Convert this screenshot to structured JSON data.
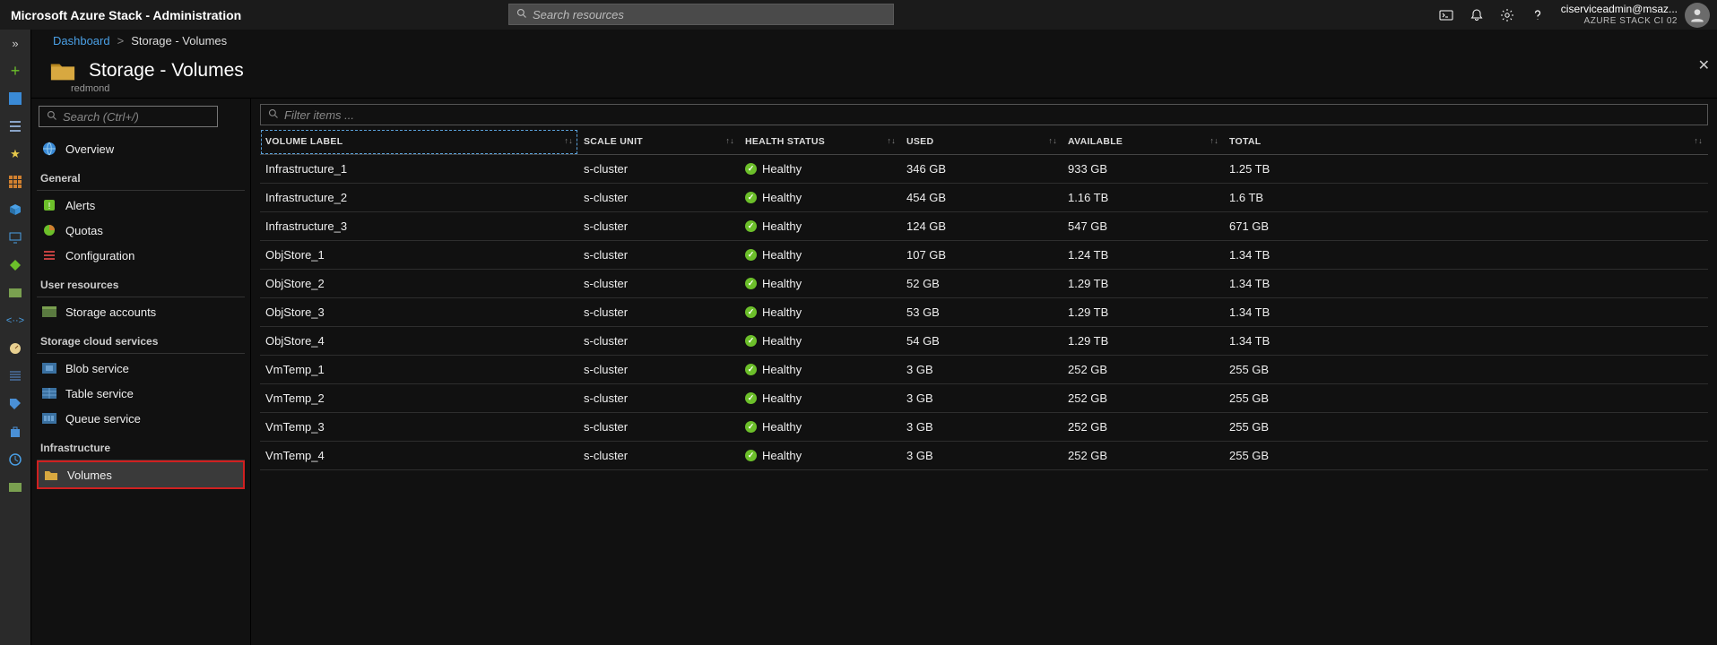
{
  "topbar": {
    "title": "Microsoft Azure Stack - Administration",
    "search_placeholder": "Search resources",
    "user": {
      "name": "ciserviceadmin@msaz...",
      "tenant": "AZURE STACK CI 02"
    }
  },
  "breadcrumb": {
    "root": "Dashboard",
    "sep": ">",
    "current": "Storage - Volumes"
  },
  "blade": {
    "title": "Storage - Volumes",
    "subtitle": "redmond"
  },
  "sidebar": {
    "search_placeholder": "Search (Ctrl+/)",
    "overview": "Overview",
    "groups": {
      "general": "General",
      "user_resources": "User resources",
      "storage_cloud": "Storage cloud services",
      "infrastructure": "Infrastructure"
    },
    "items": {
      "alerts": "Alerts",
      "quotas": "Quotas",
      "configuration": "Configuration",
      "storage_accounts": "Storage accounts",
      "blob_service": "Blob service",
      "table_service": "Table service",
      "queue_service": "Queue service",
      "volumes": "Volumes"
    }
  },
  "table": {
    "filter_placeholder": "Filter items ...",
    "headers": {
      "label": "VOLUME LABEL",
      "scale": "SCALE UNIT",
      "health": "HEALTH STATUS",
      "used": "USED",
      "available": "AVAILABLE",
      "total": "TOTAL"
    },
    "rows": [
      {
        "label": "Infrastructure_1",
        "scale": "s-cluster",
        "health": "Healthy",
        "used": "346 GB",
        "available": "933 GB",
        "total": "1.25 TB"
      },
      {
        "label": "Infrastructure_2",
        "scale": "s-cluster",
        "health": "Healthy",
        "used": "454 GB",
        "available": "1.16 TB",
        "total": "1.6 TB"
      },
      {
        "label": "Infrastructure_3",
        "scale": "s-cluster",
        "health": "Healthy",
        "used": "124 GB",
        "available": "547 GB",
        "total": "671 GB"
      },
      {
        "label": "ObjStore_1",
        "scale": "s-cluster",
        "health": "Healthy",
        "used": "107 GB",
        "available": "1.24 TB",
        "total": "1.34 TB"
      },
      {
        "label": "ObjStore_2",
        "scale": "s-cluster",
        "health": "Healthy",
        "used": "52 GB",
        "available": "1.29 TB",
        "total": "1.34 TB"
      },
      {
        "label": "ObjStore_3",
        "scale": "s-cluster",
        "health": "Healthy",
        "used": "53 GB",
        "available": "1.29 TB",
        "total": "1.34 TB"
      },
      {
        "label": "ObjStore_4",
        "scale": "s-cluster",
        "health": "Healthy",
        "used": "54 GB",
        "available": "1.29 TB",
        "total": "1.34 TB"
      },
      {
        "label": "VmTemp_1",
        "scale": "s-cluster",
        "health": "Healthy",
        "used": "3 GB",
        "available": "252 GB",
        "total": "255 GB"
      },
      {
        "label": "VmTemp_2",
        "scale": "s-cluster",
        "health": "Healthy",
        "used": "3 GB",
        "available": "252 GB",
        "total": "255 GB"
      },
      {
        "label": "VmTemp_3",
        "scale": "s-cluster",
        "health": "Healthy",
        "used": "3 GB",
        "available": "252 GB",
        "total": "255 GB"
      },
      {
        "label": "VmTemp_4",
        "scale": "s-cluster",
        "health": "Healthy",
        "used": "3 GB",
        "available": "252 GB",
        "total": "255 GB"
      }
    ]
  }
}
